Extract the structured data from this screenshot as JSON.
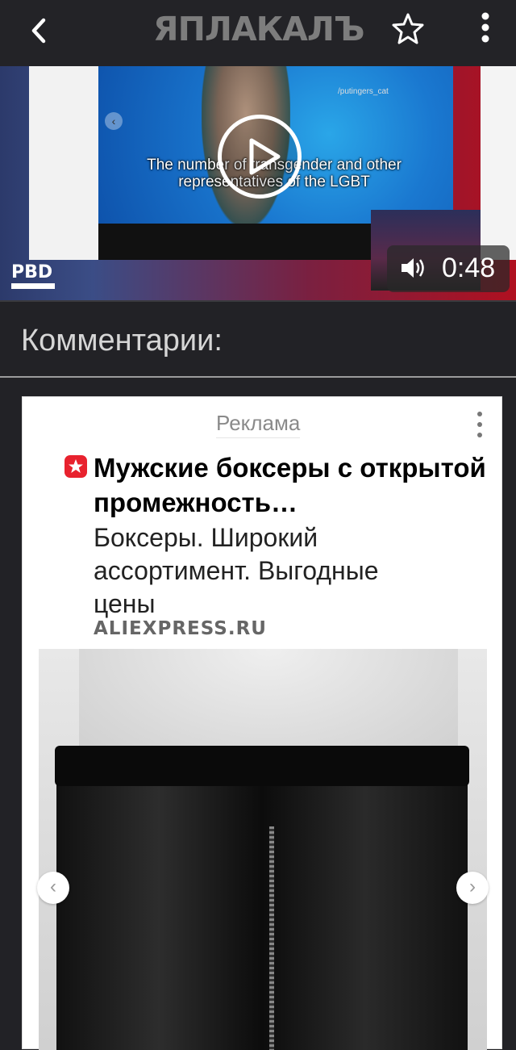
{
  "header": {
    "logo_text": "ЯПЛАКАЛЪ",
    "back_icon": "chevron-left-icon",
    "favorite_icon": "star-icon",
    "menu_icon": "more-vertical-icon"
  },
  "video": {
    "subtitle": "The number of transgender and other representatives of the LGBT",
    "handle": "/putingers_cat",
    "channel_logo": "PBD",
    "duration": "0:48",
    "play_icon": "play-icon",
    "volume_icon": "volume-icon"
  },
  "comments": {
    "title": "Комментарии:"
  },
  "ad": {
    "label": "Реклама",
    "title": "Мужские боксеры с открытой промежность…",
    "description": "Боксеры. Широкий ассортимент. Выгодные цены",
    "domain": "ALIEXPRESS.RU",
    "brand_color": "#e8222e",
    "prev_icon": "chevron-left-icon",
    "next_icon": "chevron-right-icon"
  }
}
